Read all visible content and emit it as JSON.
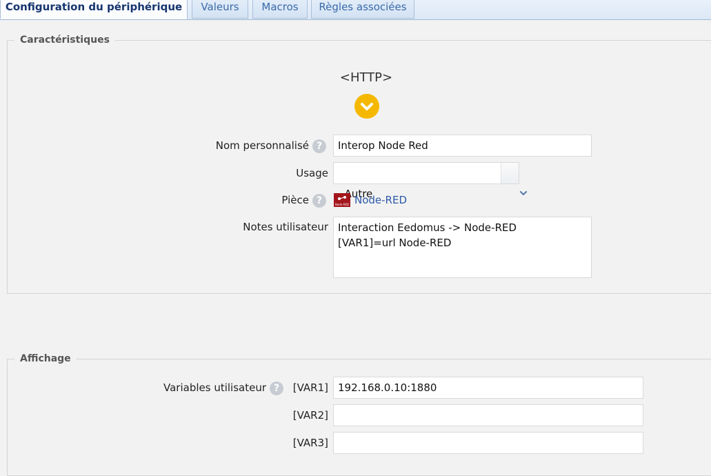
{
  "tabs": [
    {
      "label": "Configuration du périphérique",
      "active": true
    },
    {
      "label": "Valeurs",
      "active": false
    },
    {
      "label": "Macros",
      "active": false
    },
    {
      "label": "Règles associées",
      "active": false
    }
  ],
  "caracteristiques": {
    "legend": "Caractéristiques",
    "device_type": "<HTTP>",
    "nom_label": "Nom personnalisé",
    "nom_value": "Interop Node Red",
    "usage_label": "Usage",
    "usage_value": "Autre",
    "piece_label": "Pièce",
    "piece_icon_text": "Node-RED",
    "piece_value": "Node-RED",
    "notes_label": "Notes utilisateur",
    "notes_line1": "Interaction Eedomus -> Node-RED",
    "notes_line2": "[VAR1]=url Node-RED"
  },
  "affichage": {
    "legend": "Affichage",
    "variables_label": "Variables utilisateur",
    "vars": [
      {
        "name": "[VAR1]",
        "value": "192.168.0.10:1880"
      },
      {
        "name": "[VAR2]",
        "value": ""
      },
      {
        "name": "[VAR3]",
        "value": ""
      }
    ]
  },
  "help_glyph": "?",
  "colors": {
    "accent": "#f5b800",
    "link": "#2c5aa8",
    "tab_active_text": "#16356e"
  }
}
